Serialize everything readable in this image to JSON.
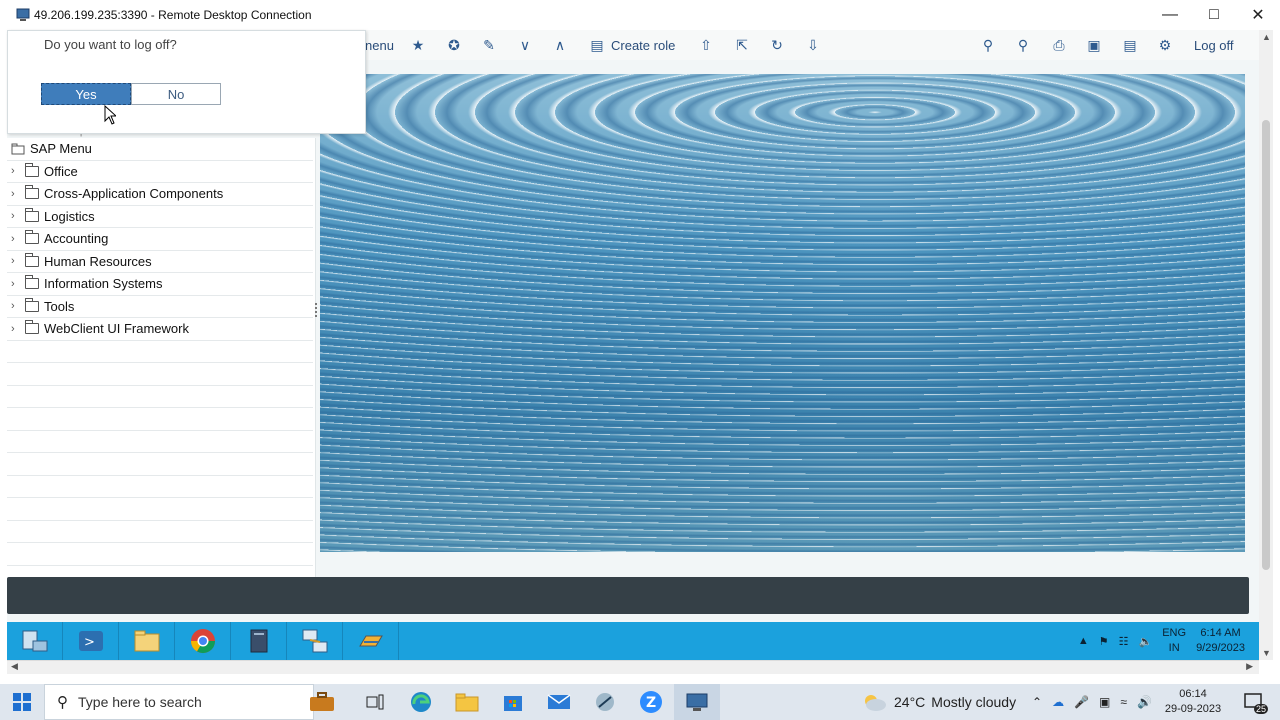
{
  "rdp_window": {
    "title": "49.206.199.235:3390 - Remote Desktop Connection",
    "controls": [
      "minimize",
      "maximize",
      "close"
    ]
  },
  "sap_toolbar": {
    "menu_label": "nenu",
    "create_role_label": "Create role",
    "log_off_label": "Log off"
  },
  "sap_menu": {
    "root_label": "SAP Menu",
    "partial_label": "... Launchpad ...",
    "items": [
      {
        "label": "Office"
      },
      {
        "label": "Cross-Application Components"
      },
      {
        "label": "Logistics"
      },
      {
        "label": "Accounting"
      },
      {
        "label": "Human Resources"
      },
      {
        "label": "Information Systems"
      },
      {
        "label": "Tools"
      },
      {
        "label": "WebClient UI Framework"
      }
    ]
  },
  "logoff_dialog": {
    "question": "Do you want to log off?",
    "yes_label": "Yes",
    "no_label": "No"
  },
  "remote_taskbar": {
    "lang_line1": "ENG",
    "lang_line2": "IN",
    "time": "6:14 AM",
    "date": "9/29/2023"
  },
  "taskbar": {
    "search_placeholder": "Type here to search",
    "weather_temp": "24°C",
    "weather_desc": "Mostly cloudy",
    "time": "06:14",
    "date": "29-09-2023",
    "notifications_count": "25"
  },
  "colors": {
    "dialog_yes_bg": "#3f7dbb",
    "remote_taskbar_bg": "#1ba1dd",
    "status_bar_bg": "#354047"
  }
}
